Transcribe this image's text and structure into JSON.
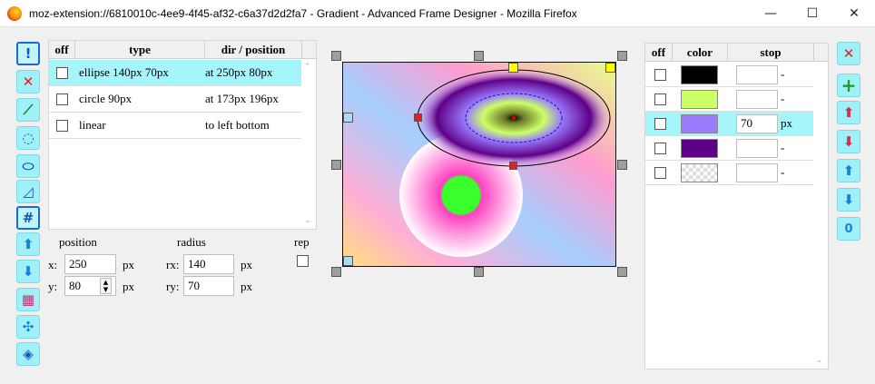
{
  "window": {
    "title": "moz-extension://6810010c-4ee9-4f45-af32-c6a37d2d2fa7 - Gradient - Advanced Frame Designer - Mozilla Firefox",
    "minimize": "—",
    "maximize": "☐",
    "close": "✕"
  },
  "left_tools": [
    {
      "icon": "info-icon",
      "glyph": "!"
    },
    {
      "icon": "delete-icon",
      "glyph": "✕"
    },
    {
      "icon": "add-linear-gradient-icon",
      "glyph": "⟋"
    },
    {
      "icon": "add-circle-gradient-icon",
      "glyph": "◌"
    },
    {
      "icon": "add-ellipse-gradient-icon",
      "glyph": "⬭"
    },
    {
      "icon": "add-conic-gradient-icon",
      "glyph": "◿"
    },
    {
      "icon": "frame-select-icon",
      "glyph": "#"
    },
    {
      "icon": "move-up-icon",
      "glyph": "⬆"
    },
    {
      "icon": "move-down-icon",
      "glyph": "⬇"
    },
    {
      "icon": "color-grid-icon",
      "glyph": "▦"
    },
    {
      "icon": "center-icon",
      "glyph": "✣"
    },
    {
      "icon": "flip-horizontal-icon",
      "glyph": "◈"
    }
  ],
  "shape_table": {
    "headers": {
      "off": "off",
      "type": "type",
      "dir": "dir / position"
    },
    "rows": [
      {
        "type": "ellipse 140px 70px",
        "dir": "at 250px 80px",
        "off": false
      },
      {
        "type": "circle 90px",
        "dir": "at 173px 196px",
        "off": false
      },
      {
        "type": "linear",
        "dir": "to left bottom",
        "off": false
      }
    ],
    "selected_index": 0
  },
  "props": {
    "position_label": "position",
    "radius_label": "radius",
    "rep_label": "rep",
    "x_label": "x:",
    "y_label": "y:",
    "rx_label": "rx:",
    "ry_label": "ry:",
    "x": "250",
    "y": "80",
    "rx": "140",
    "ry": "70",
    "unit": "px",
    "rep": false
  },
  "stops": {
    "headers": {
      "off": "off",
      "color": "color",
      "stop": "stop"
    },
    "rows": [
      {
        "color": "#000000",
        "stop": "",
        "unit": "-"
      },
      {
        "color": "#ccff66",
        "stop": "",
        "unit": "-"
      },
      {
        "color": "#9a7cff",
        "stop": "70",
        "unit": "px"
      },
      {
        "color": "#5e0087",
        "stop": "",
        "unit": "-"
      },
      {
        "color": "transparent",
        "stop": "",
        "unit": "-"
      }
    ],
    "selected_index": 2
  },
  "right_tools": [
    {
      "icon": "delete-stop-icon",
      "glyph": "✕"
    },
    {
      "icon": "add-stop-icon",
      "glyph": "+"
    },
    {
      "icon": "move-stop-up-icon",
      "glyph": "⬆"
    },
    {
      "icon": "move-stop-down-icon",
      "glyph": "⬇"
    },
    {
      "icon": "arrow-up-icon",
      "glyph": "⬆"
    },
    {
      "icon": "arrow-down-icon",
      "glyph": "⬇"
    },
    {
      "icon": "reset-zero-icon",
      "glyph": "0"
    }
  ],
  "colors": {
    "accent": "#9ff0f8",
    "selected_row": "#a6f5fb"
  }
}
